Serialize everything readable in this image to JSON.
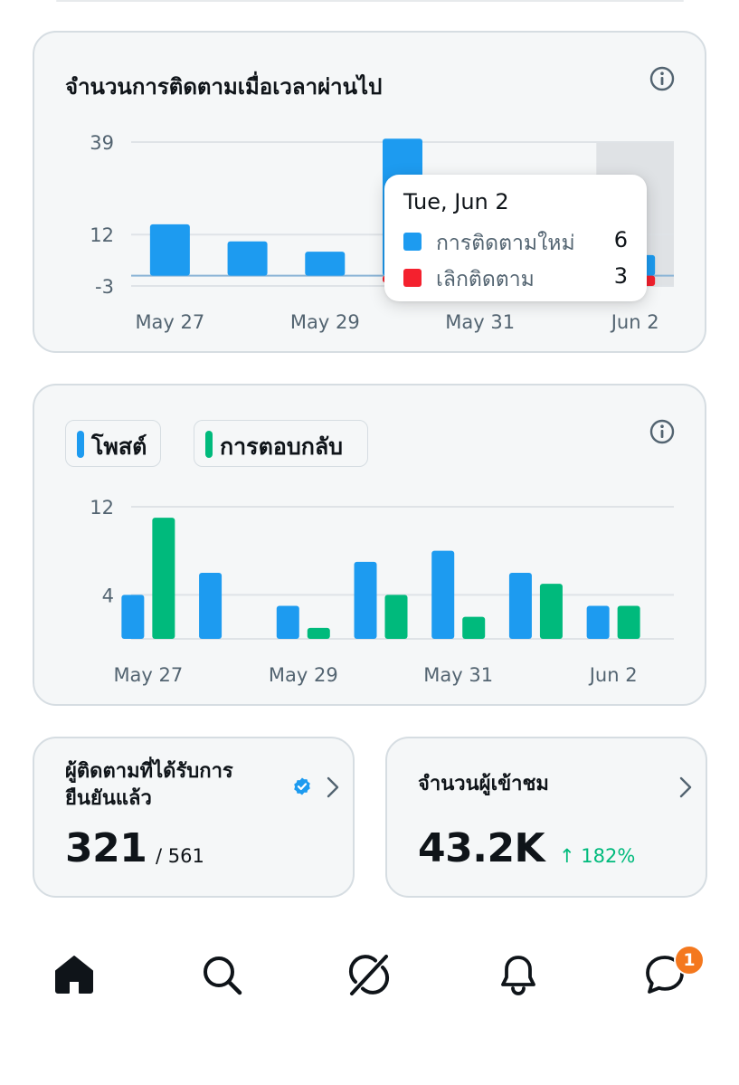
{
  "followers_card": {
    "title": "จำนวนการติดตามเมื่อเวลาผ่านไป",
    "tooltip": {
      "date": "Tue, Jun 2",
      "rows": [
        {
          "label": "การติดตามใหม่",
          "value": "6",
          "color": "#1d9bf0"
        },
        {
          "label": "เลิกติดตาม",
          "value": "3",
          "color": "#f4212e"
        }
      ]
    }
  },
  "activity_card": {
    "legend": [
      {
        "label": "โพสต์",
        "color": "#1d9bf0"
      },
      {
        "label": "การตอบกลับ",
        "color": "#00ba7c"
      }
    ]
  },
  "verified_card": {
    "title": "ผู้ติดตามที่ได้รับการยืนยันแล้ว",
    "value": "321",
    "total": "/ 561"
  },
  "impressions_card": {
    "title": "จำนวนผู้เข้าชม",
    "value": "43.2K",
    "change": "↑ 182%"
  },
  "bottom_nav": {
    "items": [
      "home-icon",
      "search-icon",
      "grok-icon",
      "notifications-icon",
      "messages-icon"
    ],
    "messages_badge": "1"
  },
  "chart_data": [
    {
      "type": "bar",
      "categories": [
        "May 27",
        "May 28",
        "May 29",
        "May 30",
        "May 31",
        "Jun 1",
        "Jun 2"
      ],
      "x_tick_labels": [
        "May 27",
        "May 29",
        "May 31",
        "Jun 2"
      ],
      "y_ticks": [
        39,
        12,
        -3
      ],
      "ylim": [
        -3,
        39
      ],
      "series": [
        {
          "name": "การติดตามใหม่",
          "color": "#1d9bf0",
          "values": [
            15,
            10,
            7,
            40,
            5,
            4,
            6
          ]
        },
        {
          "name": "เลิกติดตาม",
          "color": "#f4212e",
          "values": [
            0,
            0,
            0,
            -2,
            -2,
            0,
            -3
          ]
        }
      ],
      "highlighted_category": "Jun 2",
      "grid": true
    },
    {
      "type": "bar",
      "categories": [
        "May 27",
        "May 28",
        "May 29",
        "May 30",
        "May 31",
        "Jun 1",
        "Jun 2"
      ],
      "x_tick_labels": [
        "May 27",
        "May 29",
        "May 31",
        "Jun 2"
      ],
      "y_ticks": [
        12,
        4
      ],
      "ylim": [
        0,
        12
      ],
      "series": [
        {
          "name": "โพสต์",
          "color": "#1d9bf0",
          "values": [
            4,
            6,
            3,
            7,
            8,
            6,
            3
          ]
        },
        {
          "name": "การตอบกลับ",
          "color": "#00ba7c",
          "values": [
            11,
            0,
            1,
            4,
            2,
            5,
            3
          ]
        }
      ],
      "grid": true
    }
  ]
}
